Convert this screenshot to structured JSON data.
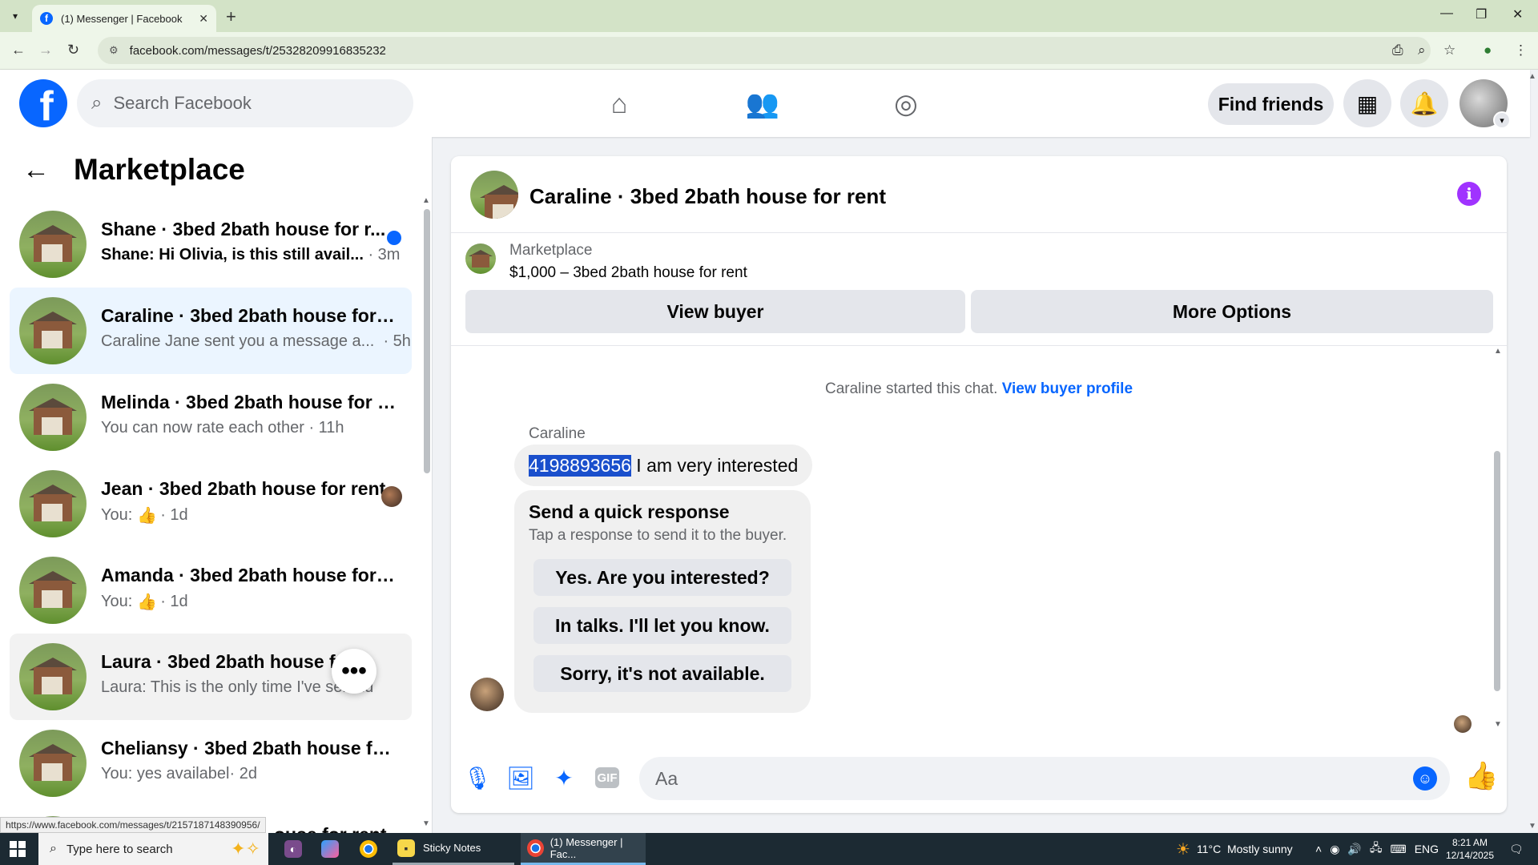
{
  "browser": {
    "tab_title": "(1) Messenger | Facebook",
    "url": "facebook.com/messages/t/25328209916835232",
    "status_url": "https://www.facebook.com/messages/t/2157187148390956/"
  },
  "header": {
    "search_placeholder": "Search Facebook",
    "find_friends": "Find friends"
  },
  "left_panel": {
    "title": "Marketplace",
    "conversations": [
      {
        "name": "Shane · 3bed 2bath house for r...",
        "preview": "Shane: Hi Olivia, is this still avail...",
        "time": "· 3m",
        "unread": true
      },
      {
        "name": "Caraline · 3bed 2bath house for r...",
        "preview": "Caraline Jane sent you a message a...",
        "time": "· 5h",
        "active": true
      },
      {
        "name": "Melinda · 3bed 2bath house for r...",
        "preview": "You can now rate each other",
        "time": "· 11h"
      },
      {
        "name": "Jean · 3bed 2bath house for rent",
        "preview": "You:",
        "time": "· 1d"
      },
      {
        "name": "Amanda · 3bed 2bath house for r...",
        "preview": "You:",
        "time": "· 1d"
      },
      {
        "name": "Laura · 3bed 2bath house for rent",
        "preview": "Laura: This is the only time I've sen",
        "time": "2d"
      },
      {
        "name": "Cheliansy · 3bed 2bath house for...",
        "preview": "You: yes availabel",
        "time": "· 2d"
      },
      {
        "name": "ouse for rent",
        "preview": "",
        "time": ""
      }
    ]
  },
  "chat": {
    "title": "Caraline · 3bed 2bath house for rent",
    "marketplace_label": "Marketplace",
    "listing": "$1,000 – 3bed 2bath house for rent",
    "view_buyer": "View buyer",
    "more_options": "More Options",
    "started_text": "Caraline started this chat.",
    "view_buyer_profile": "View buyer profile",
    "sender": "Caraline",
    "message_highlight": "4198893656",
    "message_rest": " I am very interested",
    "quick_response_title": "Send a quick response",
    "quick_response_sub": "Tap a response to send it to the buyer.",
    "quick_responses": [
      "Yes. Are you interested?",
      "In talks. I'll let you know.",
      "Sorry, it's not available."
    ],
    "composer_placeholder": "Aa"
  },
  "taskbar": {
    "search_placeholder": "Type here to search",
    "apps": [
      {
        "label": "Sticky Notes"
      },
      {
        "label": "(1) Messenger | Fac..."
      }
    ],
    "weather": "11°C  Mostly sunny",
    "lang": "ENG",
    "time": "8:21 AM",
    "date": "12/14/2025"
  },
  "colors": {
    "facebook_blue": "#0866ff",
    "active_conv_bg": "#ebf5ff",
    "selection_highlight": "#1a4fcc",
    "info_purple": "#a033ff"
  }
}
